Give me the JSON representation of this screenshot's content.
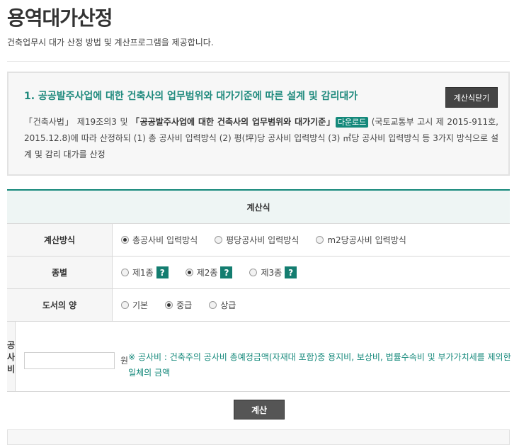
{
  "page": {
    "title": "용역대가산정",
    "subtitle": "건축업무시 대가 산정 방법 및 계산프로그램을 제공합니다."
  },
  "info": {
    "heading": "1. 공공발주사업에 대한 건축사의 업무범위와 대가기준에 따른 설계 및 감리대가",
    "close_label": "계산식닫기",
    "text_part1": "「건축사법」 제19조의3 및 ",
    "text_bold": "「공공발주사업에 대한 건축사의 업무범위와 대가기준」",
    "download_label": "다운로드",
    "text_part2": " (국토교통부 고시 제 2015-911호, 2015.12.8)에 따라 산정하되 (1) 총 공사비 입력방식 (2) 평(坪)당 공사비 입력방식 (3) ㎡당 공사비 입력방식 등 3가지 방식으로 설계 및 감리 대가를 산정"
  },
  "calc": {
    "header": "계산식",
    "method": {
      "label": "계산방식",
      "options": [
        "총공사비 입력방식",
        "평당공사비 입력방식",
        "m2당공사비 입력방식"
      ],
      "selected": "총공사비 입력방식"
    },
    "type": {
      "label": "종별",
      "options": [
        "제1종",
        "제2종",
        "제3종"
      ],
      "selected": "제2종",
      "help": "?"
    },
    "quantity": {
      "label": "도서의 양",
      "options": [
        "기본",
        "중급",
        "상급"
      ],
      "selected": "중급"
    },
    "cost": {
      "label": "공사비",
      "value": "",
      "placeholder": "",
      "unit": "원",
      "note": "※ 공사비 : 건축주의 공사비 총예정금액(자재대 포함)중 용지비, 보상비, 법률수속비 및 부가가치세를 제외한 일체의 금액"
    },
    "submit_label": "계산"
  },
  "colors": {
    "accent": "#13887a",
    "heading": "#1f8a7d",
    "button": "#444444"
  }
}
